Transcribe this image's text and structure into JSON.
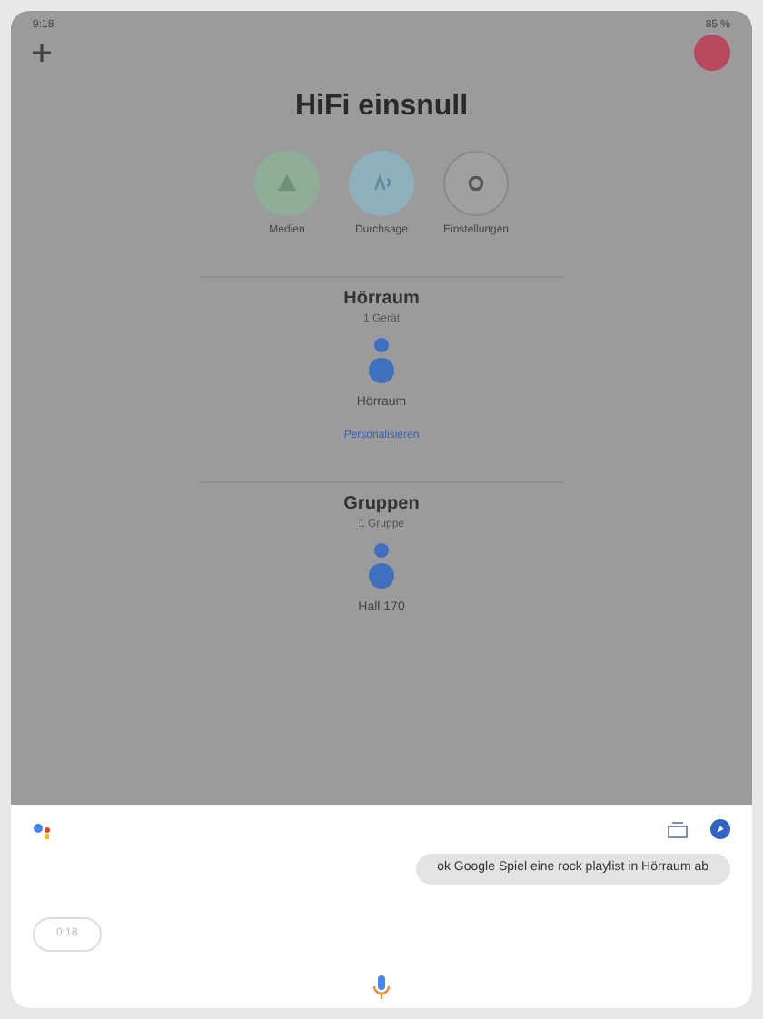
{
  "status_bar": {
    "time": "9:18",
    "battery": "85 %"
  },
  "home": {
    "title": "HiFi einsnull",
    "actions": [
      {
        "label": "Medien",
        "kind": "media"
      },
      {
        "label": "Durchsage",
        "kind": "broadcast"
      },
      {
        "label": "Einstellungen",
        "kind": "settings"
      }
    ],
    "sections": [
      {
        "title": "Hörraum",
        "subtitle": "1 Gerät",
        "device": "Hörraum",
        "link": "Personalisieren"
      },
      {
        "title": "Gruppen",
        "subtitle": "1 Gruppe",
        "device": "Hall 170"
      }
    ]
  },
  "assistant": {
    "query": "ok Google Spiel eine rock playlist in Hörraum ab",
    "chip": "0:18"
  }
}
